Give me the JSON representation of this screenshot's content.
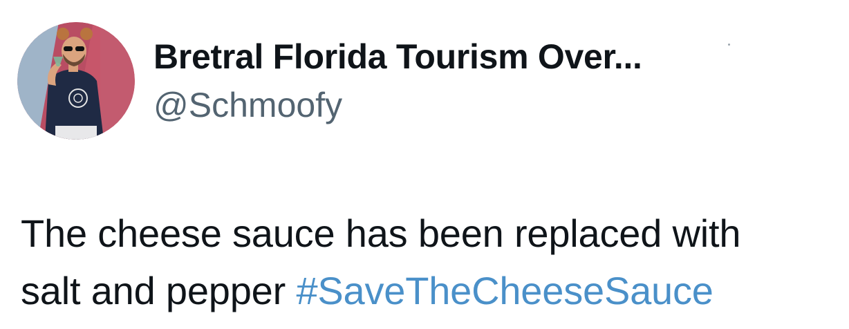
{
  "author": {
    "display_name": "Bretral Florida Tourism Over...",
    "handle": "@Schmoofy",
    "avatar_icon": "profile-photo"
  },
  "tweet": {
    "line1": "The cheese sauce has been replaced with",
    "line2_text": "salt and pepper ",
    "hashtag": "#SaveTheCheeseSauce"
  },
  "colors": {
    "text": "#0f1419",
    "handle": "#536471",
    "hashtag": "#4a90c9",
    "background": "#ffffff"
  }
}
